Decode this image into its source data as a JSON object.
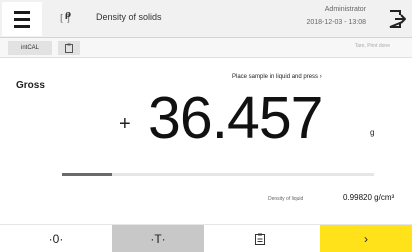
{
  "header": {
    "menu_icon": "hamburger-menu-icon",
    "app_icon": "density-icon",
    "app_icon_symbol": "ρ",
    "app_icon_bracket": "[ ]",
    "title": "Density of solids",
    "user": "Administrator",
    "datetime": "2018-12-03 - 13:08",
    "exit_icon": "logout-icon"
  },
  "toolbar": {
    "cal_label": "intCAL",
    "clipboard_icon": "clipboard-icon",
    "note": "Tare, Print done"
  },
  "main": {
    "result_label": "Gross",
    "instruction": "Place sample in liquid and press",
    "instruction_arrow": "›",
    "sign": "+",
    "weight": "36.457",
    "unit": "g",
    "progress_fraction": 0.16,
    "density_label": "Density of liquid",
    "density_value": "0.99820 g/cm³"
  },
  "bottom_bar": {
    "zero_label": "·0·",
    "tare_label": "·T·",
    "print_icon": "print-icon",
    "next_label": "›",
    "next_color": "#ffe21a",
    "tare_active_color": "#c8c8c8"
  }
}
